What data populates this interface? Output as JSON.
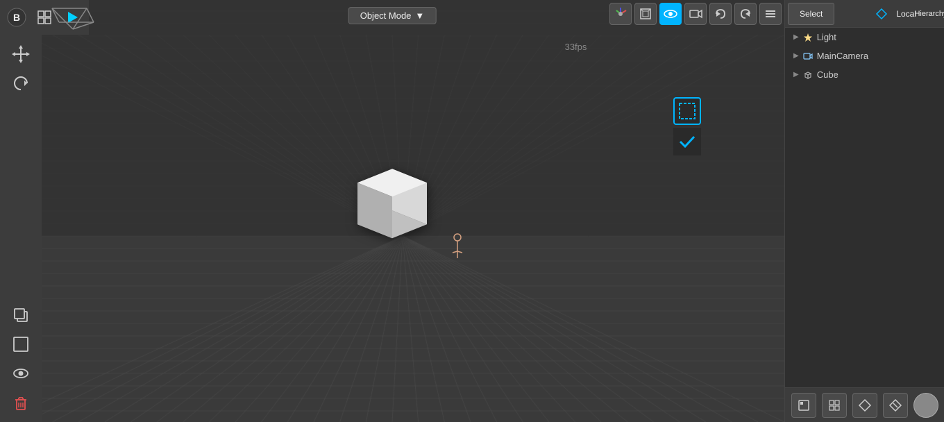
{
  "viewport": {
    "mode": "Object Mode",
    "fps": "33fps"
  },
  "toolbar": {
    "select_label": "Select",
    "local_label": "Local",
    "hierarchy_label": "Hierarchy"
  },
  "hierarchy": {
    "items": [
      {
        "label": "Light",
        "icon": "▶",
        "type": "light"
      },
      {
        "label": "MainCamera",
        "icon": "▶",
        "type": "camera"
      },
      {
        "label": "Cube",
        "icon": "▶",
        "type": "mesh"
      }
    ]
  },
  "icons": {
    "grid_icon": "⊞",
    "play_icon": "▶",
    "move_icon": "✥",
    "copy_icon": "⧉",
    "frame_icon": "☐",
    "eye_icon": "👁",
    "delete_icon": "🗑",
    "undo_icon": "↩",
    "redo_icon": "↪",
    "menu_icon": "≡",
    "gizmo_icon": "◉",
    "camera_icon": "📷",
    "render_icon": "◉",
    "globe_icon": "🌐",
    "scene_icon": "⊡",
    "layers_icon": "⧉",
    "cube_icon": "⬜",
    "check_icon": "✔",
    "select_box_icon": "⬚"
  },
  "bottom_panel": {
    "buttons": [
      "◼",
      "⊞",
      "⬡",
      "⬡"
    ]
  }
}
